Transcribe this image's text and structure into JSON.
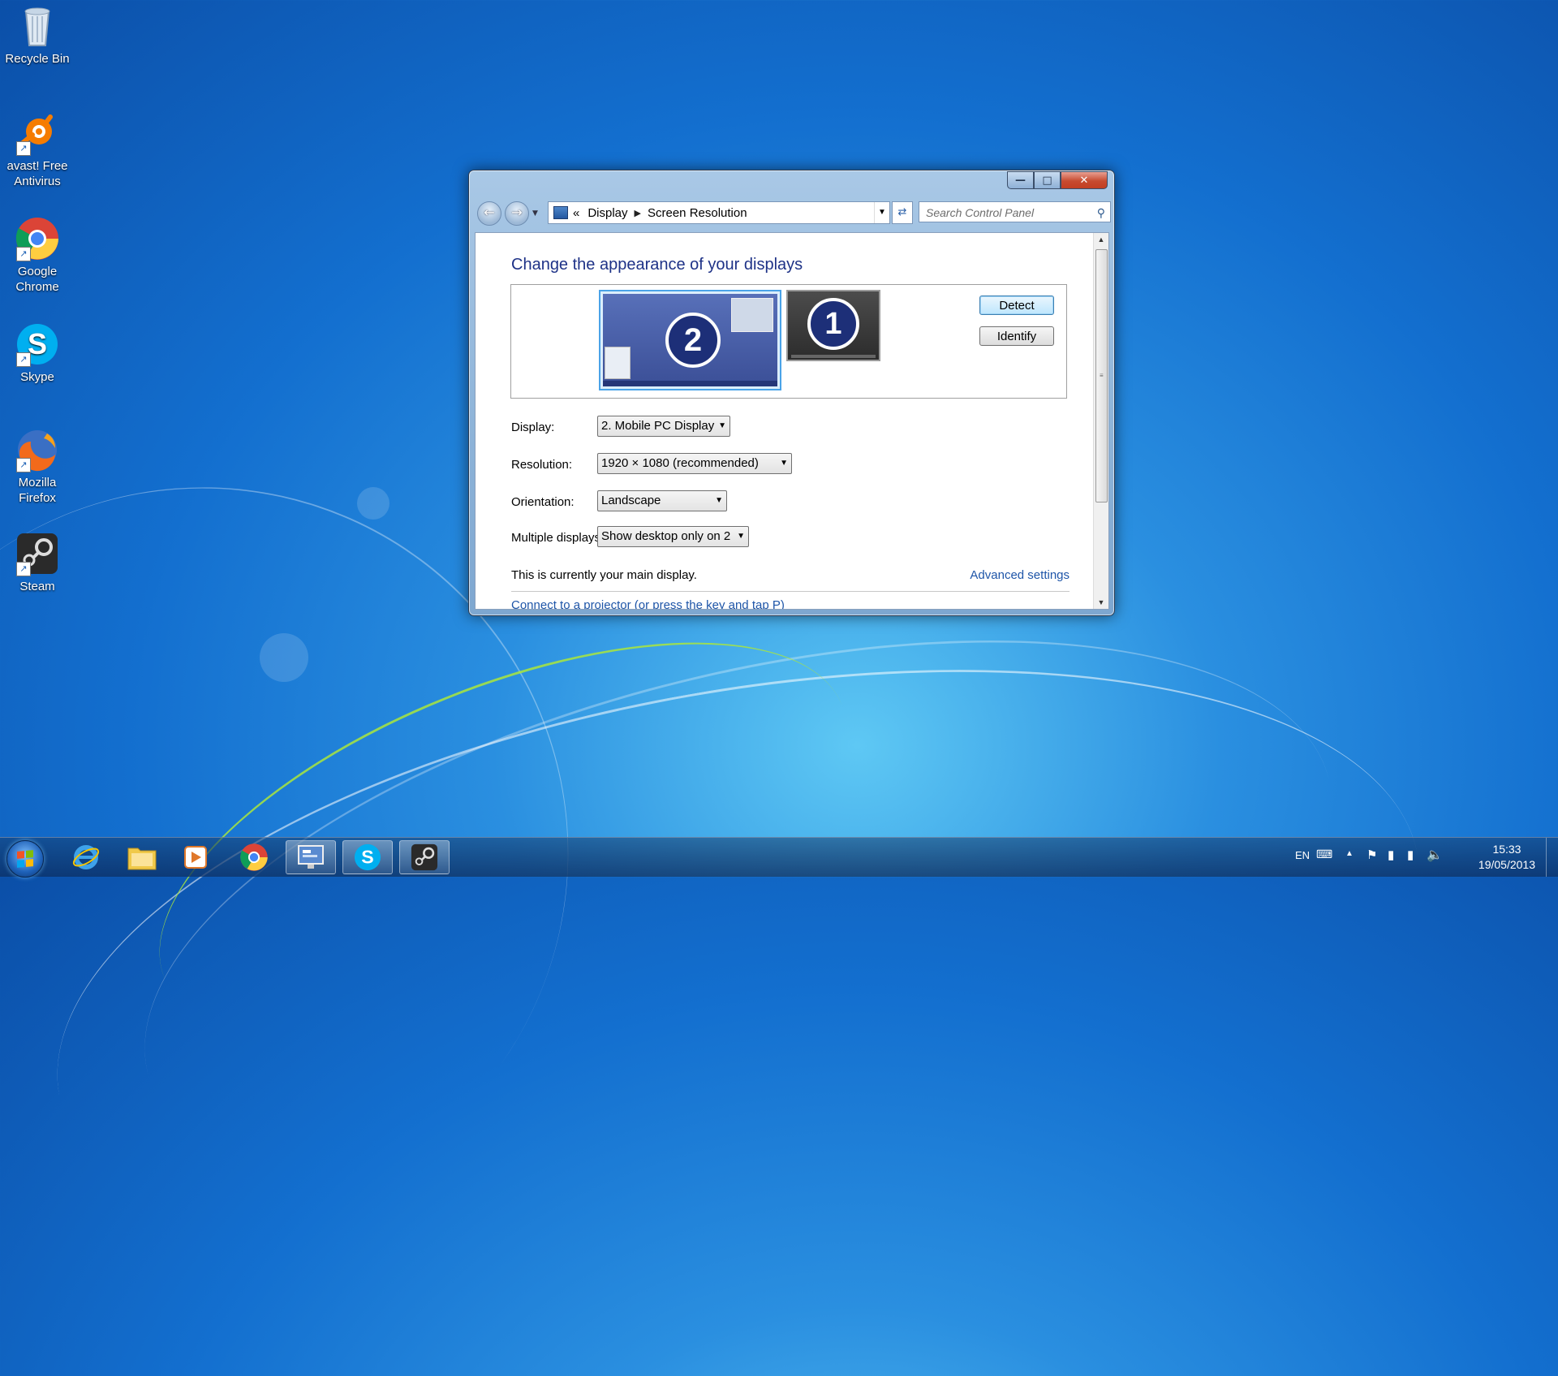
{
  "desktop": {
    "icons": [
      {
        "label": "Recycle Bin"
      },
      {
        "label": "avast! Free Antivirus"
      },
      {
        "label": "Google Chrome"
      },
      {
        "label": "Skype"
      },
      {
        "label": "Mozilla Firefox"
      },
      {
        "label": "Steam"
      }
    ]
  },
  "window": {
    "breadcrumb": {
      "root": "«",
      "items": [
        "Display",
        "Screen Resolution"
      ]
    },
    "search_placeholder": "Search Control Panel",
    "heading": "Change the appearance of your displays",
    "monitors": [
      {
        "number": "2",
        "selected": true
      },
      {
        "number": "1",
        "selected": false
      }
    ],
    "buttons": {
      "detect": "Detect",
      "identify": "Identify"
    },
    "fields": {
      "display": {
        "label": "Display:",
        "value": "2. Mobile PC Display"
      },
      "resolution": {
        "label": "Resolution:",
        "value": "1920 × 1080 (recommended)"
      },
      "orientation": {
        "label": "Orientation:",
        "value": "Landscape"
      },
      "multiple": {
        "label": "Multiple displays:",
        "value": "Show desktop only on 2"
      }
    },
    "info_text": "This is currently your main display.",
    "advanced_link": "Advanced settings",
    "cut_off_text": "Connect to a projector (or press the  key and tap P)"
  },
  "taskbar": {
    "language": "EN",
    "time": "15:33",
    "date": "19/05/2013"
  }
}
